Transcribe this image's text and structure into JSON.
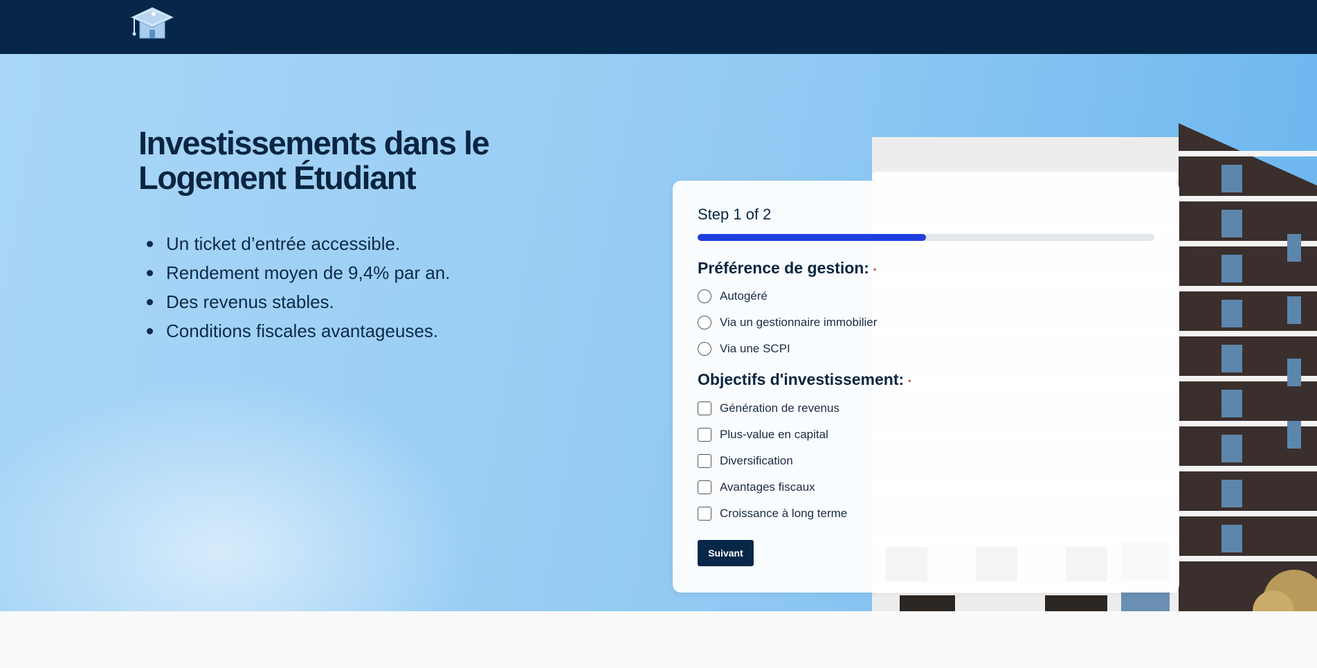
{
  "header": {
    "logo_icon": "graduation-cap-house-icon",
    "bg_color": "#062748"
  },
  "hero": {
    "title": "Investissements dans le Logement Étudiant",
    "bullets": [
      "Un ticket d’entrée accessible.",
      "Rendement moyen de 9,4% par an.",
      "Des revenus stables.",
      "Conditions fiscales avantageuses."
    ]
  },
  "form": {
    "step_label": "Step 1 of 2",
    "progress_fraction": 0.5,
    "accent_color": "#1f3fe0",
    "required_marker": "•",
    "management": {
      "title": "Préférence de gestion:",
      "options": [
        "Autogéré",
        "Via un gestionnaire immobilier",
        "Via une SCPI"
      ]
    },
    "objectives": {
      "title": "Objectifs d'investissement:",
      "options": [
        "Génération de revenus",
        "Plus-value en capital",
        "Diversification",
        "Avantages fiscaux",
        "Croissance à long terme"
      ]
    },
    "next_label": "Suivant"
  }
}
